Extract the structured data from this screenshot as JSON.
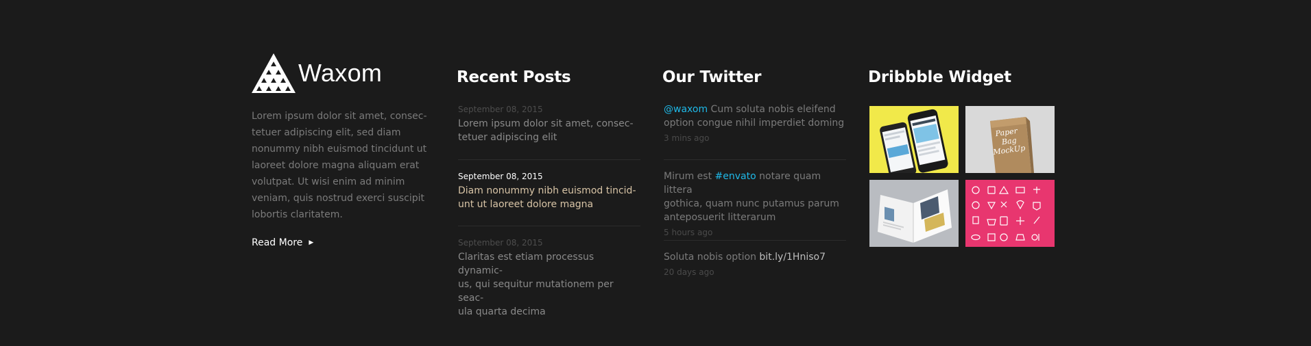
{
  "about": {
    "logo_text": "Waxom",
    "text_lines": [
      "Lorem ipsum dolor sit amet, consec-",
      "tetuer adipiscing elit, sed diam",
      "nonummy nibh euismod tincidunt ut",
      "laoreet dolore magna aliquam erat",
      "volutpat. Ut wisi enim ad minim",
      "veniam, quis nostrud exerci suscipit",
      "lobortis claritatem."
    ],
    "read_more_label": "Read More",
    "read_more_icon": "caret-right-icon"
  },
  "posts": {
    "title": "Recent Posts",
    "items": [
      {
        "date": "September 08, 2015",
        "title_lines": [
          "Lorem ipsum dolor sit amet, consec-",
          "tetuer adipiscing elit"
        ]
      },
      {
        "date": "September 08, 2015",
        "title_lines": [
          "Diam nonummy nibh euismod tincid-",
          "unt ut laoreet dolore magna"
        ]
      },
      {
        "date": "September 08, 2015",
        "title_lines": [
          "Claritas est etiam processus dynamic-",
          "us, qui sequitur mutationem per seac-",
          "ula quarta decima"
        ]
      }
    ]
  },
  "twitter": {
    "title": "Our Twitter",
    "tweets": [
      {
        "handle": "@waxom",
        "text_a": " Cum soluta nobis eleifend",
        "text_b": "option congue nihil imperdiet doming",
        "time": "3 mins ago"
      },
      {
        "pre": "Mirum est ",
        "tag": "#envato",
        "text_a": " notare quam littera",
        "text_b": "gothica, quam nunc putamus parum",
        "text_c": "anteposuerit litterarum",
        "time": "5 hours ago"
      },
      {
        "pre": "Soluta nobis option ",
        "link": "bit.ly/1Hniso7",
        "time": "20 days ago"
      }
    ]
  },
  "dribbble": {
    "title": "Dribbble Widget",
    "shots": [
      {
        "name": "phone-mockup",
        "color": "#f1e94a"
      },
      {
        "name": "paper-bag-mockup",
        "text": "Paper Bag MockUp",
        "color": "#d9d9d9"
      },
      {
        "name": "magazine-mockup",
        "color": "#b9bcc1"
      },
      {
        "name": "icon-set",
        "color": "#e8366f"
      }
    ]
  },
  "colors": {
    "background": "#1b1b1b",
    "accent_blue": "#1fb9e8",
    "active_post": "#d8c4a6",
    "icon_set_pink": "#e8366f"
  }
}
